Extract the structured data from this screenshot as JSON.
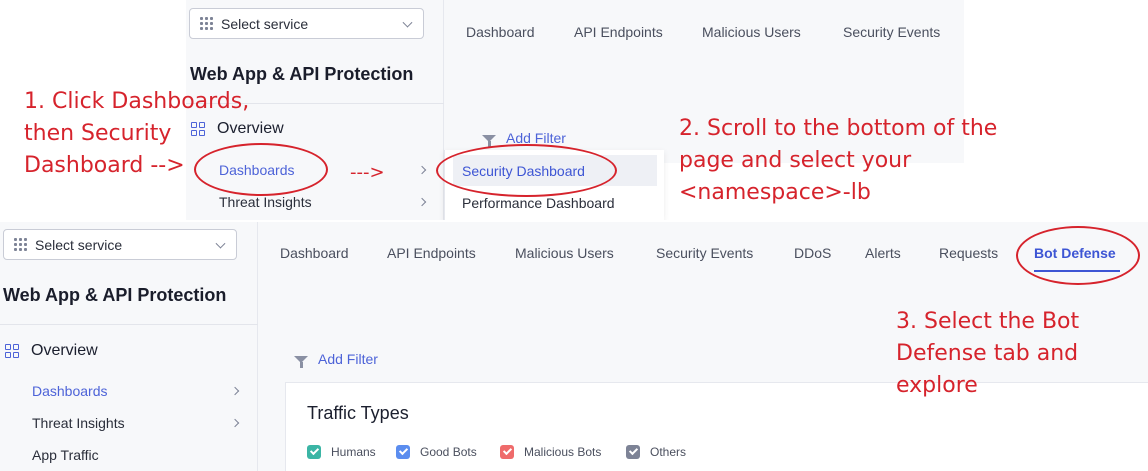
{
  "top": {
    "select_service": "Select service",
    "app_title": "Web App & API Protection",
    "overview": "Overview",
    "nav": [
      {
        "label": "Dashboards"
      },
      {
        "label": "Threat Insights"
      }
    ],
    "tabs": [
      "Dashboard",
      "API Endpoints",
      "Malicious Users",
      "Security Events"
    ],
    "add_filter": "Add Filter",
    "flyout": [
      {
        "label": "Security Dashboard",
        "selected": true
      },
      {
        "label": "Performance Dashboard",
        "selected": false
      }
    ]
  },
  "bottom": {
    "select_service": "Select service",
    "app_title": "Web App & API Protection",
    "overview": "Overview",
    "nav": [
      {
        "label": "Dashboards"
      },
      {
        "label": "Threat Insights"
      },
      {
        "label": "App Traffic"
      }
    ],
    "tabs": [
      "Dashboard",
      "API Endpoints",
      "Malicious Users",
      "Security Events",
      "DDoS",
      "Alerts",
      "Requests",
      "Bot Defense"
    ],
    "active_tab": "Bot Defense",
    "add_filter": "Add Filter",
    "card_title": "Traffic Types",
    "legend": [
      {
        "label": "Humans",
        "color": "#3bb5a5"
      },
      {
        "label": "Good Bots",
        "color": "#5b8def"
      },
      {
        "label": "Malicious Bots",
        "color": "#ef6b6b"
      },
      {
        "label": "Others",
        "color": "#7d8396"
      }
    ]
  },
  "annotations": {
    "step1": "1. Click Dashboards,\nthen Security\nDashboard -->",
    "arrow": "--->",
    "step2": "2. Scroll to the bottom of the\npage and select your\n<namespace>-lb",
    "step3": "3. Select the Bot\nDefense tab and\nexplore"
  },
  "colors": {
    "annotation": "#d6232c",
    "accent": "#3d55d4"
  }
}
